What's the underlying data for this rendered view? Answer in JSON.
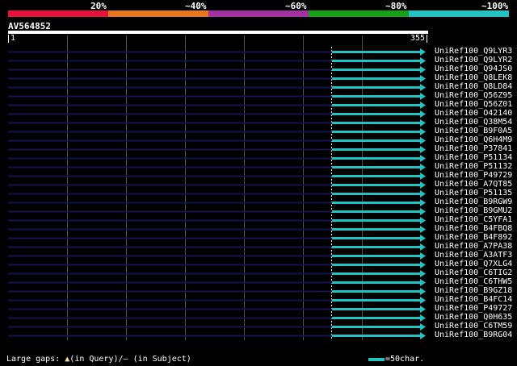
{
  "legend": {
    "labels": [
      "20%",
      "~40%",
      "~60%",
      "~80%",
      "~100%"
    ],
    "colors": [
      "#e8123c",
      "#e8761c",
      "#a431a4",
      "#16a016",
      "#22c3c3"
    ]
  },
  "query": {
    "id": "AV564852",
    "start": "1",
    "end": "355"
  },
  "hits": [
    "UniRef100_Q9LYR3",
    "UniRef100_Q9LYR2",
    "UniRef100_Q94JS0",
    "UniRef100_Q8LEK8",
    "UniRef100_Q8LD84",
    "UniRef100_Q56Z95",
    "UniRef100_Q56Z01",
    "UniRef100_O42140",
    "UniRef100_Q38M54",
    "UniRef100_B9F0A5",
    "UniRef100_Q6H4M9",
    "UniRef100_P37841",
    "UniRef100_P51134",
    "UniRef100_P51132",
    "UniRef100_P49729",
    "UniRef100_A7QT85",
    "UniRef100_P51135",
    "UniRef100_B9RGW9",
    "UniRef100_B9GMU2",
    "UniRef100_C5YFA1",
    "UniRef100_B4FBQ8",
    "UniRef100_B4F892",
    "UniRef100_A7PA38",
    "UniRef100_A3ATF3",
    "UniRef100_Q7XLG4",
    "UniRef100_C6TIG2",
    "UniRef100_C6THW5",
    "UniRef100_B9GZ18",
    "UniRef100_B4FC14",
    "UniRef100_P49727",
    "UniRef100_Q0H635",
    "UniRef100_C6TM59",
    "UniRef100_B9RG04"
  ],
  "colors": {
    "hit_bar": "#22c3c3",
    "unaligned": "#141450",
    "grid": "#505050"
  },
  "footer": {
    "gaps_prefix": "Large gaps:",
    "gaps_glyph": "▲",
    "gaps_text": "(in Query)/– (in Subject)",
    "scale_text": "=50char."
  }
}
